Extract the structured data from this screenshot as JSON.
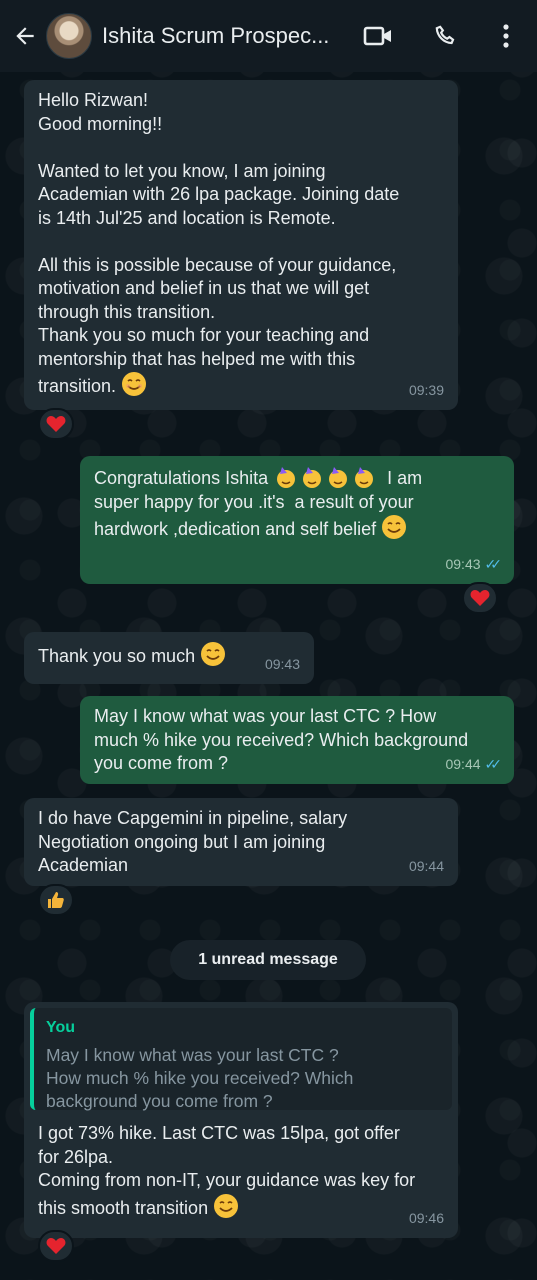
{
  "header": {
    "contact_name": "Ishita Scrum Prospec...",
    "icons": [
      "back-arrow-icon",
      "video-call-icon",
      "phone-icon",
      "more-options-icon"
    ]
  },
  "messages": [
    {
      "direction": "incoming",
      "text": "Hello Rizwan!\nGood morning!!\n\nWanted to let you know, I am joining\nAcademian with 26 lpa package. Joining date\nis 14th Jul'25 and location is Remote.\n\nAll this is possible because of your guidance,\nmotivation and belief in us that we will get\nthrough this transition.\nThank you so much for your teaching and\nmentorship that has helped me with this\ntransition.",
      "time": "09:39",
      "reaction": "heart"
    },
    {
      "direction": "outgoing",
      "text_a": "Congratulations Ishita",
      "text_b": " I am\nsuper happy for you .it's  a result of your\nhardwork ,dedication and self belief",
      "time": "09:43",
      "reaction": "heart"
    },
    {
      "direction": "incoming",
      "text": "Thank you so much",
      "time": "09:43"
    },
    {
      "direction": "outgoing",
      "text": "May I know what was your last CTC ? How\nmuch % hike you received? Which background\nyou come from ?",
      "time": "09:44"
    },
    {
      "direction": "incoming",
      "text": "I do have Capgemini in pipeline, salary\nNegotiation ongoing but I am joining\nAcademian",
      "time": "09:44",
      "reaction": "thumbs-up"
    },
    {
      "direction": "incoming",
      "quote_author": "You",
      "quote_text": "May I know what was your last CTC ?\nHow much % hike you received? Which\nbackground you come from ?",
      "text": "I got 73% hike. Last CTC was 15lpa, got offer\nfor 26lpa.\nComing from non-IT, your guidance was key for\nthis smooth transition",
      "time": "09:46",
      "reaction": "heart"
    }
  ],
  "unread_label": "1 unread message",
  "colors": {
    "incoming_bubble": "#202c33",
    "outgoing_bubble": "#1f5b3f",
    "read_tick": "#53bdeb",
    "quote_accent": "#06cf9c"
  }
}
